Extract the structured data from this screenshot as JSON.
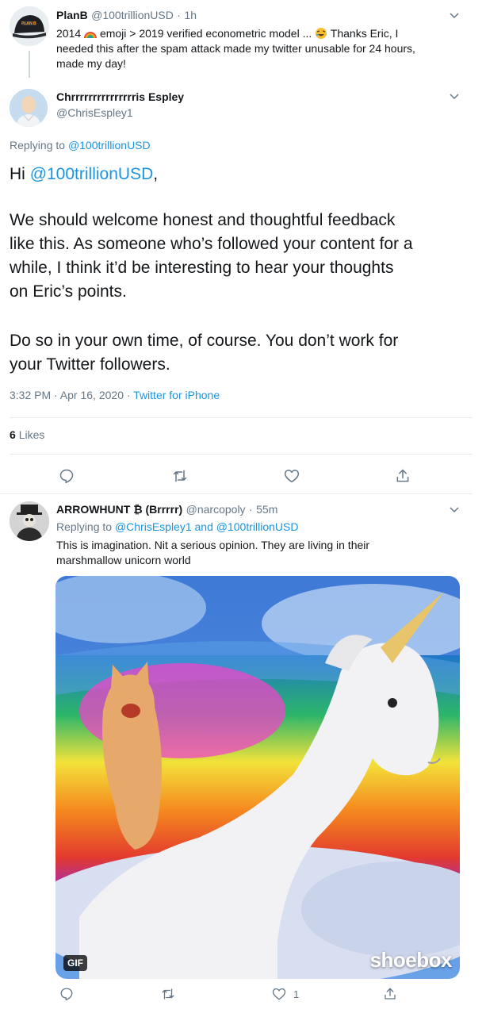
{
  "tweet1": {
    "name": "PlanB",
    "handle": "@100trillionUSD",
    "separator": "·",
    "time": "1h",
    "text_a": "2014",
    "text_b": "emoji > 2019 verified econometric model ...",
    "text_c": "Thanks Eric, I",
    "text_line2": "needed this after the spam attack made my twitter unusable for 24 hours,",
    "text_line3": "made my day!",
    "avatar_label": "PLAN B"
  },
  "main_tweet": {
    "name": "Chrrrrrrrrrrrrrrris Espley",
    "handle": "@ChrisEspley1",
    "replying_prefix": "Replying to",
    "replying_to": "@100trillionUSD",
    "greeting": "Hi",
    "greeting_mention": "@100trillionUSD",
    "greeting_end": ",",
    "paragraph1": "We should welcome honest and thoughtful feedback\nlike this. As someone who’s followed your content for a\nwhile, I think it’d be interesting to hear your thoughts\non Eric’s points.",
    "paragraph2": "Do so in your own time, of course. You don’t work for\nyour Twitter followers.",
    "timestamp": "3:32 PM · Apr 16, 2020 ·",
    "source": "Twitter for iPhone",
    "likes_count": "6",
    "likes_label": "Likes"
  },
  "reply": {
    "name": "ARROWHUNT ₿ (Brrrrr)",
    "handle": "@narcopoly",
    "separator": "·",
    "time": "55m",
    "replying_prefix": "Replying to",
    "replying_to_1": "@ChrisEspley1",
    "replying_and": "and",
    "replying_to_2": "@100trillionUSD",
    "text_line1": "This is imagination. Nit a serious opinion. They are living in their",
    "text_line2": "marshmallow unicorn world",
    "gif_badge": "GIF",
    "watermark": "shoebox",
    "like_count": "1"
  },
  "colors": {
    "link": "#1b95e0",
    "secondary": "#657786",
    "divider": "#e6ecf0"
  },
  "icons": [
    "chevron-down-icon",
    "rainbow-emoji",
    "laughing-emoji",
    "reply-icon",
    "retweet-icon",
    "like-icon",
    "share-icon"
  ]
}
